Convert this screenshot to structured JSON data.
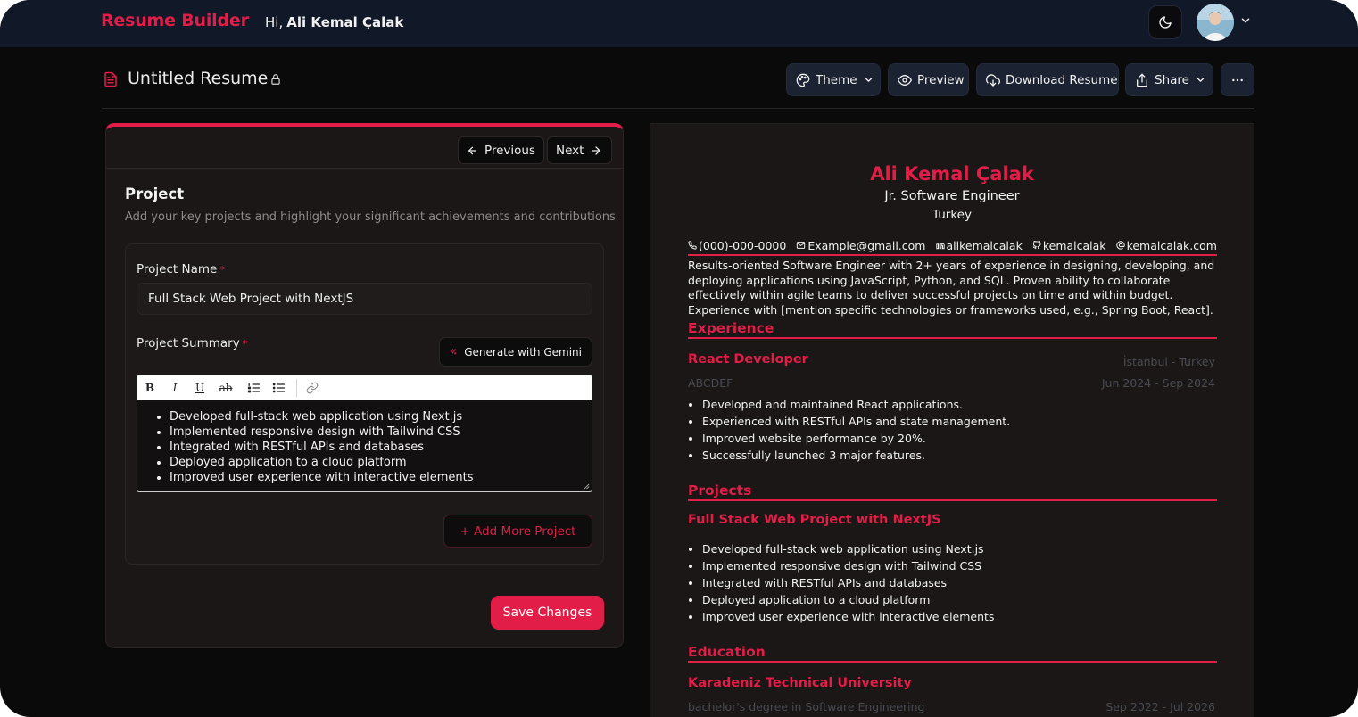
{
  "navbar": {
    "brand": "Resume Builder",
    "greeting": "Hi,",
    "user_name": "Ali Kemal Çalak"
  },
  "header": {
    "title": "Untitled Resume",
    "buttons": {
      "theme": "Theme",
      "preview": "Preview",
      "download": "Download Resume",
      "share": "Share"
    }
  },
  "form": {
    "nav": {
      "previous": "Previous",
      "next": "Next"
    },
    "section_title": "Project",
    "section_subtitle": "Add your key projects and highlight your significant achievements and contributions",
    "project_name_label": "Project Name",
    "required_mark": "*",
    "project_name_value": "Full Stack Web Project with NextJS",
    "project_summary_label": "Project Summary",
    "gemini_button": "Generate with Gemini",
    "toolbar": {
      "bold": "B",
      "italic": "I",
      "underline": "U",
      "strike": "ab"
    },
    "summary_items": [
      "Developed full-stack web application using Next.js",
      "Implemented responsive design with Tailwind CSS",
      "Integrated with RESTful APIs and databases",
      "Deployed application to a cloud platform",
      "Improved user experience with interactive elements"
    ],
    "add_more_button": "+ Add More Project",
    "save_button": "Save Changes"
  },
  "resume": {
    "name": "Ali Kemal Çalak",
    "role": "Jr. Software Engineer",
    "location": "Turkey",
    "contacts": {
      "phone": "(000)-000-0000",
      "email": "Example@gmail.com",
      "linkedin": "alikemalcalak",
      "github": "kemalcalak",
      "website": "kemalcalak.com"
    },
    "summary": "Results-oriented Software Engineer with 2+ years of experience in designing, developing, and deploying applications using JavaScript, Python, and SQL. Proven ability to collaborate effectively within agile teams to deliver successful projects on time and within budget. Experience with [mention specific technologies or frameworks used, e.g., Spring Boot, React].",
    "experience_heading": "Experience",
    "experience": {
      "title": "React Developer",
      "location": "İstanbul - Turkey",
      "company": "ABCDEF",
      "dates": "Jun 2024 - Sep 2024",
      "bullets": [
        "Developed and maintained React applications.",
        "Experienced with RESTful APIs and state management.",
        "Improved website performance by 20%.",
        "Successfully launched 3 major features."
      ]
    },
    "projects_heading": "Projects",
    "project": {
      "title": "Full Stack Web Project with NextJS",
      "bullets": [
        "Developed full-stack web application using Next.js",
        "Implemented responsive design with Tailwind CSS",
        "Integrated with RESTful APIs and databases",
        "Deployed application to a cloud platform",
        "Improved user experience with interactive elements"
      ]
    },
    "education_heading": "Education",
    "education": {
      "school": "Karadeniz Technical University",
      "degree": "bachelor's degree in Software Engineering",
      "dates": "Sep 2022 - Jul 2026"
    }
  },
  "colors": {
    "accent": "#e11d48",
    "navbar_bg": "#111827",
    "page_bg": "#0b0a0a",
    "card_bg": "#1a1716"
  },
  "icons": {
    "theme_toggle": "moon-icon",
    "document": "file-text-icon",
    "lock": "lock-icon",
    "theme": "palette-icon",
    "preview": "eye-icon",
    "download": "cloud-download-icon",
    "share": "share-icon",
    "more": "more-horizontal-icon",
    "previous": "arrow-left-icon",
    "next": "arrow-right-icon",
    "gemini": "sparkle-icon",
    "add": "plus-icon"
  }
}
